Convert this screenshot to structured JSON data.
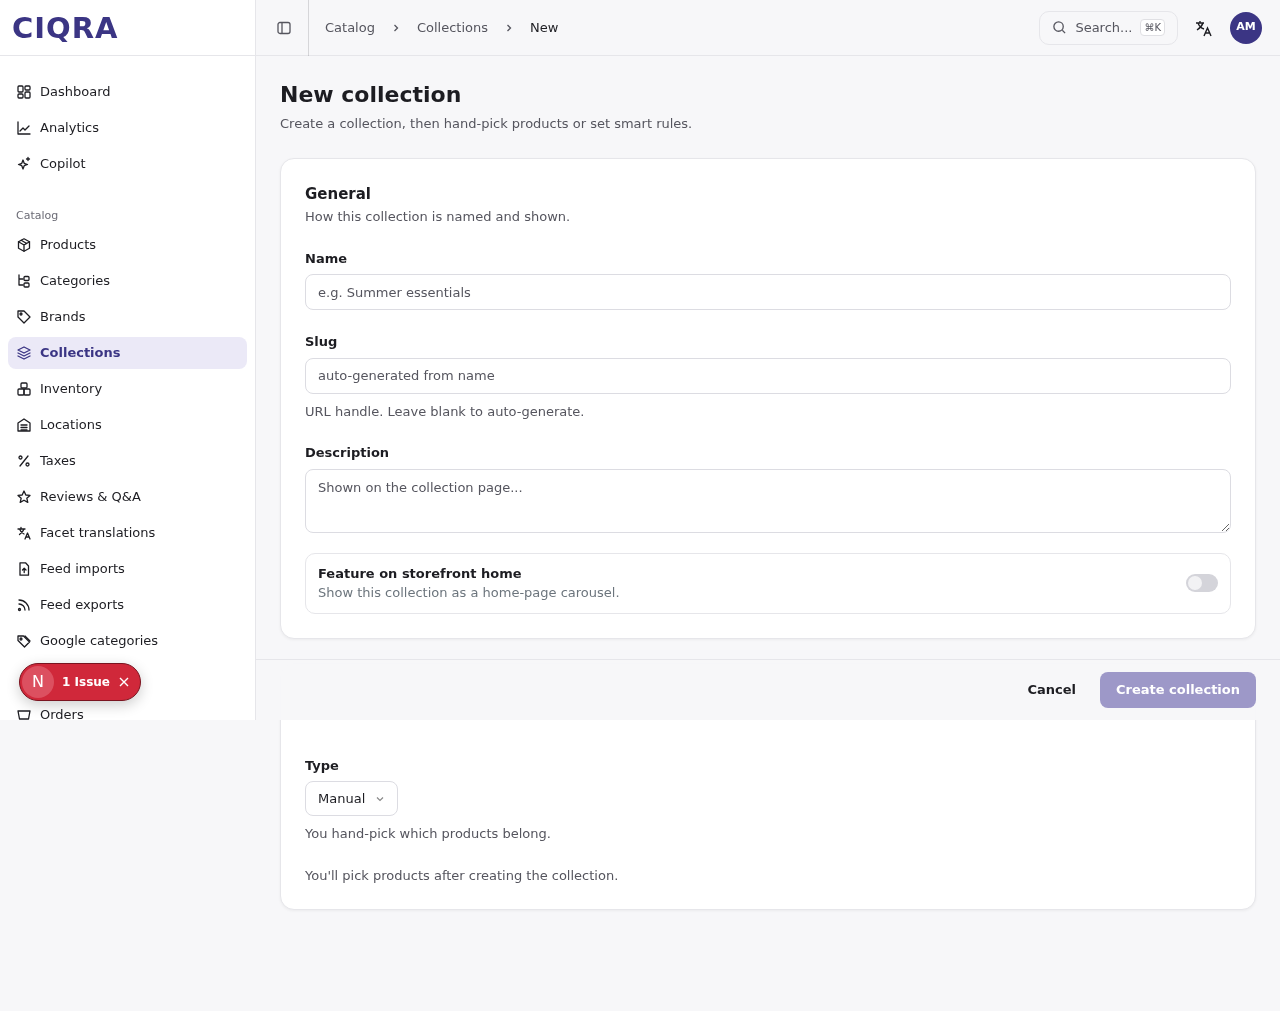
{
  "logo": "CIQRA",
  "sidebar": {
    "groups": [
      {
        "items": [
          {
            "label": "Dashboard",
            "selected": false
          },
          {
            "label": "Analytics",
            "selected": false
          },
          {
            "label": "Copilot",
            "selected": false
          }
        ]
      },
      {
        "title": "Catalog",
        "items": [
          {
            "label": "Products",
            "selected": false
          },
          {
            "label": "Categories",
            "selected": false
          },
          {
            "label": "Brands",
            "selected": false
          },
          {
            "label": "Collections",
            "selected": true
          },
          {
            "label": "Inventory",
            "selected": false
          },
          {
            "label": "Locations",
            "selected": false
          },
          {
            "label": "Taxes",
            "selected": false
          },
          {
            "label": "Reviews & Q&A",
            "selected": false
          },
          {
            "label": "Facet translations",
            "selected": false
          },
          {
            "label": "Feed imports",
            "selected": false
          },
          {
            "label": "Feed exports",
            "selected": false
          },
          {
            "label": "Google categories",
            "selected": false
          }
        ]
      },
      {
        "items": [
          {
            "label": "Orders",
            "selected": false
          }
        ]
      }
    ]
  },
  "issue_badge": {
    "letter": "N",
    "label": "1 Issue"
  },
  "breadcrumb": [
    "Catalog",
    "Collections",
    "New"
  ],
  "search": {
    "placeholder": "Search...",
    "shortcut": "⌘K"
  },
  "avatar": "AM",
  "page": {
    "title": "New collection",
    "subtitle": "Create a collection, then hand-pick products or set smart rules."
  },
  "general": {
    "title": "General",
    "subtitle": "How this collection is named and shown.",
    "fields": [
      {
        "kind": "input",
        "label": "Name",
        "placeholder": "e.g. Summer essentials"
      },
      {
        "kind": "input",
        "label": "Slug",
        "placeholder": "auto-generated from name",
        "help": "URL handle. Leave blank to auto-generate."
      },
      {
        "kind": "textarea",
        "label": "Description",
        "placeholder": "Shown on the collection page..."
      }
    ],
    "feature": {
      "title": "Feature on storefront home",
      "description": "Show this collection as a home-page carousel.",
      "on": false
    }
  },
  "membership": {
    "type_label": "Type",
    "type_value": "Manual",
    "type_help": "You hand-pick which products belong.",
    "note": "You'll pick products after creating the collection."
  },
  "footer": {
    "cancel": "Cancel",
    "submit": "Create collection",
    "submit_disabled": true
  }
}
